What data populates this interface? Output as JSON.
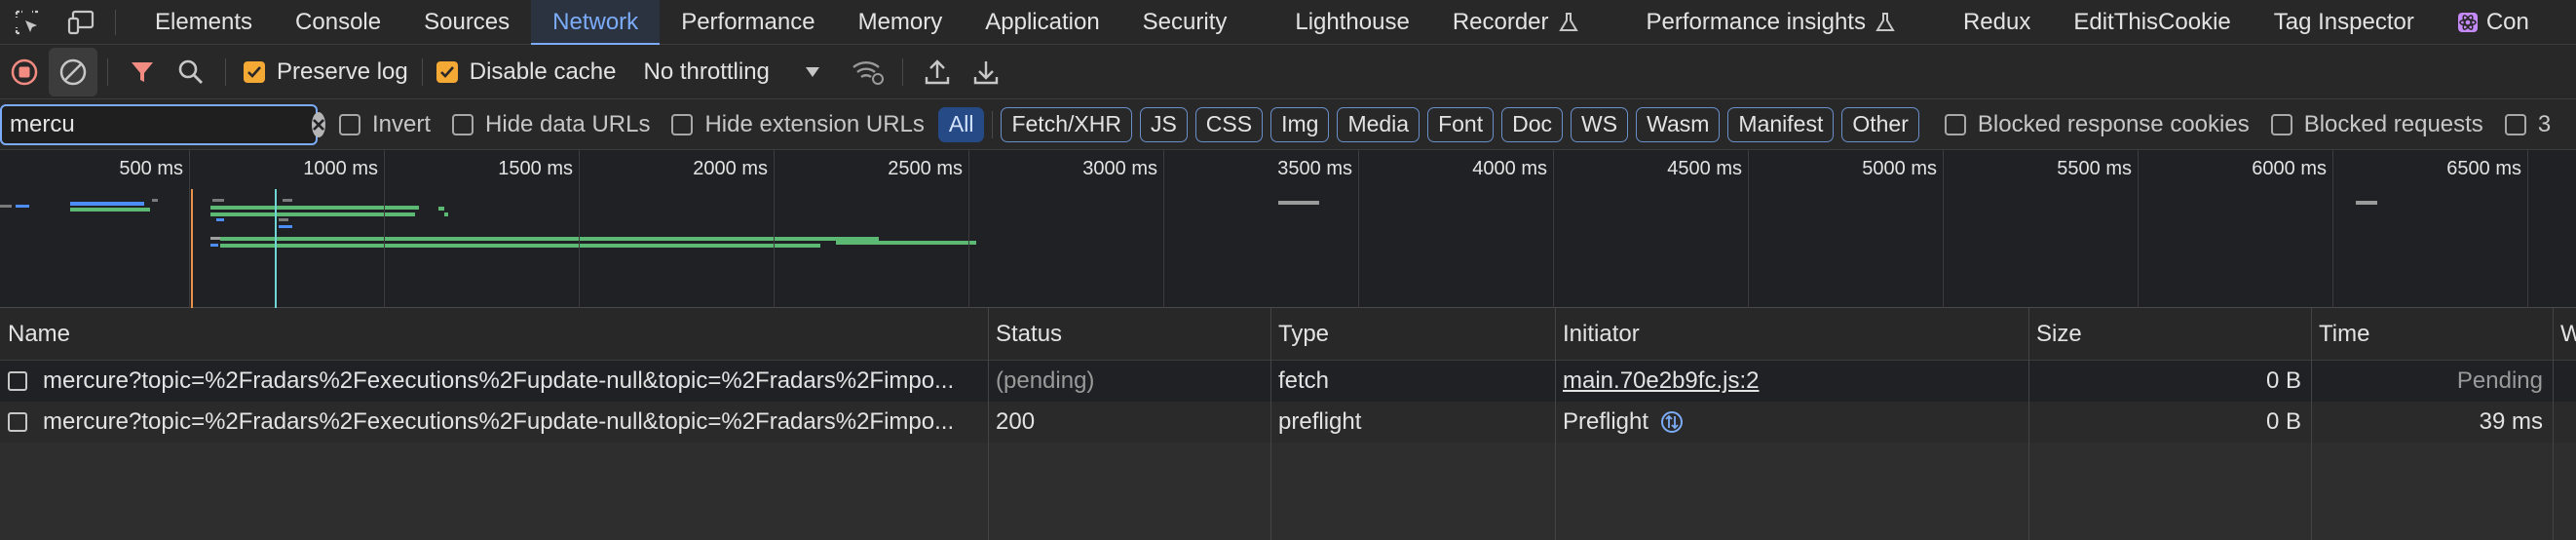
{
  "tabs": [
    {
      "label": "Elements",
      "active": false
    },
    {
      "label": "Console",
      "active": false
    },
    {
      "label": "Sources",
      "active": false
    },
    {
      "label": "Network",
      "active": true
    },
    {
      "label": "Performance",
      "active": false
    },
    {
      "label": "Memory",
      "active": false
    },
    {
      "label": "Application",
      "active": false
    },
    {
      "label": "Security",
      "active": false
    },
    {
      "label": "Lighthouse",
      "active": false
    },
    {
      "label": "Recorder",
      "active": false,
      "icon": "flask-icon"
    },
    {
      "label": "Performance insights",
      "active": false,
      "icon": "flask-icon"
    },
    {
      "label": "Redux",
      "active": false
    },
    {
      "label": "EditThisCookie",
      "active": false
    },
    {
      "label": "Tag Inspector",
      "active": false
    },
    {
      "label": "Con",
      "active": false,
      "icon": "react-icon"
    }
  ],
  "toolbar": {
    "preserve_log": {
      "label": "Preserve log",
      "checked": true
    },
    "disable_cache": {
      "label": "Disable cache",
      "checked": true
    },
    "throttling": "No throttling"
  },
  "filter": {
    "value": "mercu",
    "invert": "Invert",
    "hide_data_urls": "Hide data URLs",
    "hide_extension_urls": "Hide extension URLs",
    "types": [
      "All",
      "Fetch/XHR",
      "JS",
      "CSS",
      "Img",
      "Media",
      "Font",
      "Doc",
      "WS",
      "Wasm",
      "Manifest",
      "Other"
    ],
    "active_type": "All",
    "blocked_response_cookies": "Blocked response cookies",
    "blocked_requests": "Blocked requests",
    "third_party": "3"
  },
  "overview": {
    "ticks": [
      "500 ms",
      "1000 ms",
      "1500 ms",
      "2000 ms",
      "2500 ms",
      "3000 ms",
      "3500 ms",
      "4000 ms",
      "4500 ms",
      "5000 ms",
      "5500 ms",
      "6000 ms",
      "6500 ms"
    ]
  },
  "table": {
    "columns": [
      "Name",
      "Status",
      "Type",
      "Initiator",
      "Size",
      "Time",
      "W"
    ],
    "rows": [
      {
        "name": "mercure?topic=%2Fradars%2Fexecutions%2Fupdate-null&topic=%2Fradars%2Fimpo...",
        "status": "(pending)",
        "type": "fetch",
        "initiator": "main.70e2b9fc.js:2",
        "size": "0 B",
        "time": "Pending"
      },
      {
        "name": "mercure?topic=%2Fradars%2Fexecutions%2Fupdate-null&topic=%2Fradars%2Fimpo...",
        "status": "200",
        "type": "preflight",
        "initiator": "Preflight",
        "size": "0 B",
        "time": "39 ms"
      }
    ]
  },
  "colors": {
    "accent": "#7cacf8",
    "checkbox_on": "#f4a934",
    "record_red": "#f28b82",
    "filter_red": "#f28b82",
    "waterfall_green": "#5bb974",
    "waterfall_blue": "#4c8df6"
  }
}
